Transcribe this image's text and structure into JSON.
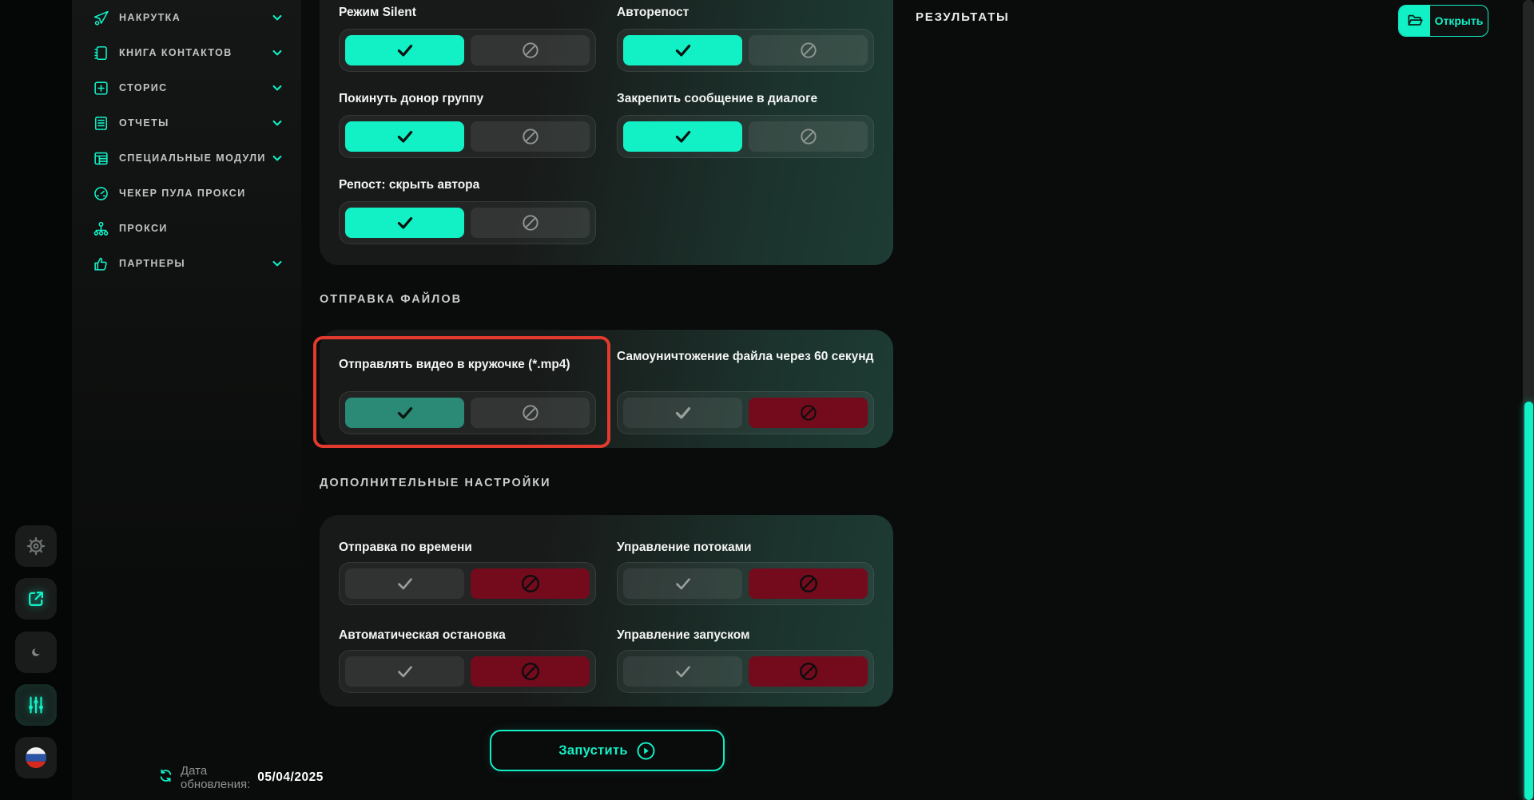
{
  "colors": {
    "accent": "#12F0C6",
    "accent_muted": "#2A8A76",
    "danger_red": "#730B1D",
    "highlight_border": "#E23A2E"
  },
  "sidebar": {
    "items": [
      {
        "label": "Накрутка",
        "icon": "send-plus-icon",
        "expandable": true
      },
      {
        "label": "Книга контактов",
        "icon": "contacts-book-icon",
        "expandable": true
      },
      {
        "label": "Сторис",
        "icon": "stories-plus-icon",
        "expandable": true
      },
      {
        "label": "Отчеты",
        "icon": "reports-icon",
        "expandable": true
      },
      {
        "label": "Специальные модули",
        "icon": "modules-icon",
        "expandable": true
      },
      {
        "label": "Чекер пула прокси",
        "icon": "proxy-checker-icon",
        "expandable": false
      },
      {
        "label": "Прокси",
        "icon": "proxy-icon",
        "expandable": false
      },
      {
        "label": "Партнеры",
        "icon": "partners-icon",
        "expandable": true
      }
    ]
  },
  "rail": {
    "buttons": [
      {
        "name": "settings",
        "icon": "gear-icon",
        "active": false
      },
      {
        "name": "open-external",
        "icon": "external-link-icon",
        "active": true
      },
      {
        "name": "theme",
        "icon": "sun-moon-icon",
        "active": false
      },
      {
        "name": "filters",
        "icon": "sliders-icon",
        "active": true
      },
      {
        "name": "language",
        "icon": "ru-flag-icon",
        "active": false
      }
    ]
  },
  "card1": {
    "toggles": [
      {
        "label": "Режим Silent",
        "state": "on"
      },
      {
        "label": "Авторепост",
        "state": "on"
      },
      {
        "label": "Покинуть донор группу",
        "state": "on"
      },
      {
        "label": "Закрепить сообщение в диалоге",
        "state": "on"
      },
      {
        "label": "Репост: скрыть автора",
        "state": "on"
      }
    ]
  },
  "file_section": {
    "title": "ОТПРАВКА ФАЙЛОВ",
    "toggles": [
      {
        "label": "Отправлять видео в кружочке (*.mp4)",
        "state": "muted-on",
        "highlighted": true
      },
      {
        "label": "Самоуничтожение файла через 60 секунд",
        "state": "off"
      }
    ]
  },
  "extra_section": {
    "title": "ДОПОЛНИТЕЛЬНЫЕ НАСТРОЙКИ",
    "toggles": [
      {
        "label": "Отправка по времени",
        "state": "off"
      },
      {
        "label": "Управление потоками",
        "state": "off"
      },
      {
        "label": "Автоматическая остановка",
        "state": "off"
      },
      {
        "label": "Управление запуском",
        "state": "off"
      }
    ]
  },
  "run_button": {
    "label": "Запустить"
  },
  "footer": {
    "update_label": "Дата обновления:",
    "update_date": "05/04/2025"
  },
  "results": {
    "title": "РЕЗУЛЬТАТЫ",
    "open_label": "Открыть"
  }
}
